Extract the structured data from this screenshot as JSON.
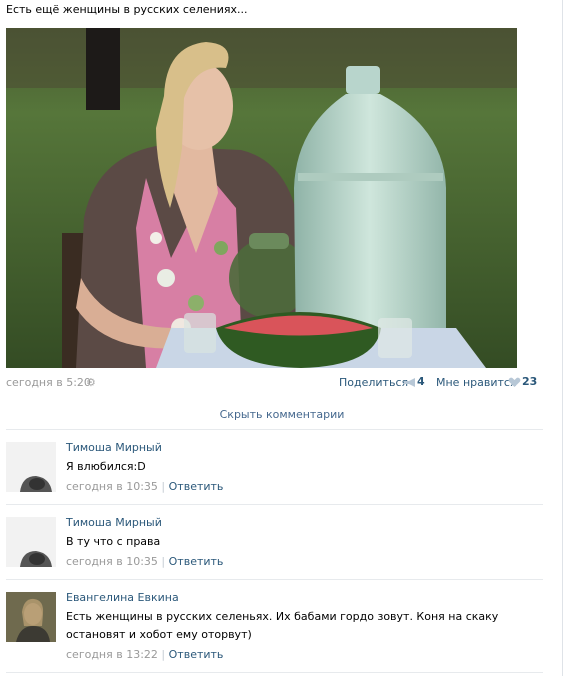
{
  "post": {
    "text": "Есть ещё женщины в русских селениях...",
    "time": "сегодня в 5:20",
    "share_label": "Поделиться",
    "share_count": "4",
    "like_label": "Мне нравится",
    "like_count": "23"
  },
  "comments_toggle": "Скрыть комментарии",
  "comments": [
    {
      "author": "Тимоша Мирный",
      "text": "Я влюбился:D",
      "date": "сегодня в 10:35",
      "reply": "Ответить"
    },
    {
      "author": "Тимоша Мирный",
      "text": "В ту что с права",
      "date": "сегодня в 10:35",
      "reply": "Ответить"
    },
    {
      "author": "Евангелина Евкина",
      "text": "Есть женщины в русских селеньях. Их бабами гордо зовут. Коня на скаку остановят и хобот ему оторвут)",
      "date": "сегодня в 13:22",
      "reply": "Ответить"
    }
  ],
  "colors": {
    "link": "#2b587a",
    "muted": "#999999",
    "separator": "#e7eaed"
  }
}
